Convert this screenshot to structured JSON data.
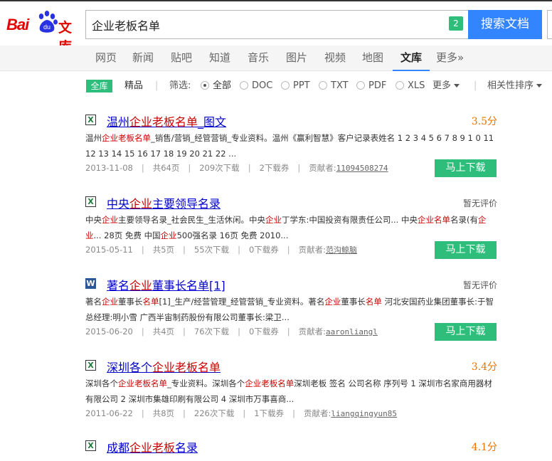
{
  "header": {
    "logo_bai": "Bai",
    "logo_du": "du",
    "logo_wenku": "文库",
    "search_value": "企业老板名单",
    "search_badge": "2",
    "search_button": "搜索文档"
  },
  "nav": {
    "items": [
      "网页",
      "新闻",
      "贴吧",
      "知道",
      "音乐",
      "图片",
      "视频",
      "地图",
      "文库",
      "更多»"
    ]
  },
  "filter": {
    "all_tag": "全库",
    "quality": "精品",
    "filter_label": "筛选:",
    "types": [
      "全部",
      "DOC",
      "PPT",
      "TXT",
      "PDF",
      "XLS"
    ],
    "more": "更多",
    "sort": "相关性排序"
  },
  "results": [
    {
      "icon": "X",
      "title_parts": [
        "",
        "温州",
        "企业老板名单",
        "_图文"
      ],
      "score": "3.5分",
      "snippet_html": "温州<em>企业老板名单</em>_销售/营销_经管营销_专业资料。温州《赢利智慧》客户记录表姓名 1 2 3 4 5 6 7 8 9 1 0 11 12 13 14 15 16 17 18 19 20 21 22 ...",
      "date": "2013-11-08",
      "pages": "共64页",
      "downloads": "209次下载",
      "coupons": "2下载券",
      "contributor_label": "贡献者:",
      "contributor": "11094508274",
      "button": "马上下载"
    },
    {
      "icon": "X",
      "title_parts": [
        "",
        "中央",
        "企业",
        "主要领导名录"
      ],
      "score": "暂无评价",
      "snippet_html": "中央<em>企业</em>主要领导名录_社会民生_生活休闲。中央<em>企业</em>丁学东:中国投资有限责任公司... 中央<em>企业名单</em>名录(有<em>企业</em>... 28页 免费 中国<em>企业</em>500强名录 16页 免费 2010...",
      "date": "2015-05-11",
      "pages": "共5页",
      "downloads": "55次下载",
      "coupons": "0下载券",
      "contributor_label": "贡献者:",
      "contributor": "范沟鲸脑",
      "button": "马上下载"
    },
    {
      "icon": "W",
      "title_parts": [
        "",
        "著名",
        "企业",
        "董事长名单[1]"
      ],
      "score": "暂无评价",
      "snippet_html": "著名<em>企业</em>董事长<em>名单</em>[1]_生产/经营管理_经管营销_专业资料。著名<em>企业</em>董事长<em>名单</em> 河北安国药业集团董事长:于智 总经理:明小雪 广西半宙制药股份有限公司董事长:梁卫...",
      "date": "2015-06-20",
      "pages": "共4页",
      "downloads": "76次下载",
      "coupons": "0下载券",
      "contributor_label": "贡献者:",
      "contributor": "aaronliangl",
      "button": "马上下载"
    },
    {
      "icon": "X",
      "title_parts": [
        "",
        "深圳各个",
        "企业老板名单",
        ""
      ],
      "score": "3.4分",
      "snippet_html": "深圳各个<em>企业老板名单</em>_专业资料。深圳各个<em>企业老板名单</em>深圳老板 签名 公司名称 序列号 1 深圳市名家商用器材有限公司 2 深圳市集雄印刷有限公司 4 深圳市万事喜商...",
      "date": "2011-06-22",
      "pages": "共8页",
      "downloads": "226次下载",
      "coupons": "1下载券",
      "contributor_label": "贡献者:",
      "contributor": "liangqingyun85",
      "button": ""
    },
    {
      "icon": "X",
      "title_parts": [
        "",
        "成都",
        "企业老板",
        "名录"
      ],
      "score": "4.1分",
      "snippet_html": "",
      "date": "",
      "pages": "",
      "downloads": "",
      "coupons": "",
      "contributor_label": "",
      "contributor": "",
      "button": ""
    }
  ]
}
